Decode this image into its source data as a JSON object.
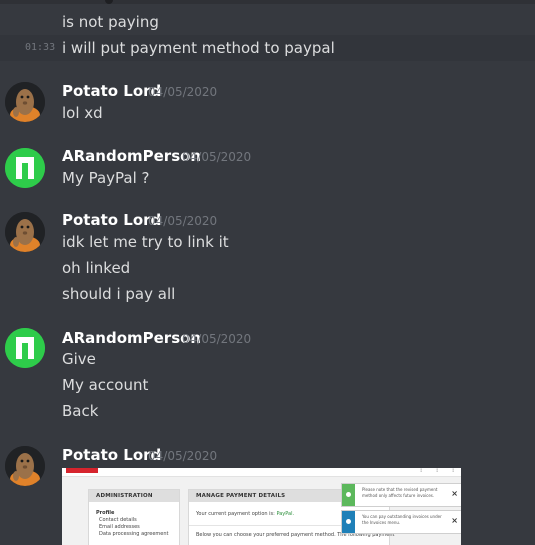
{
  "continuation": {
    "line1": "is not paying",
    "line2_time": "01:33",
    "line2": "i will put payment method to paypal"
  },
  "messages": [
    {
      "author": "Potato Lord",
      "date": "04/05/2020",
      "avatar": "potato-avatar",
      "lines": [
        "lol xd"
      ]
    },
    {
      "author": "ARandomPerson",
      "date": "04/05/2020",
      "avatar": "manjaro-logo-avatar",
      "lines": [
        "My PayPal ?"
      ]
    },
    {
      "author": "Potato Lord",
      "date": "04/05/2020",
      "avatar": "potato-avatar",
      "lines": [
        "idk let me try to link it",
        "oh linked",
        "should i pay all"
      ]
    },
    {
      "author": "ARandomPerson",
      "date": "04/05/2020",
      "avatar": "manjaro-logo-avatar",
      "lines": [
        "Give",
        "My account",
        "Back"
      ]
    },
    {
      "author": "Potato Lord",
      "date": "04/05/2020",
      "avatar": "potato-avatar",
      "lines": []
    }
  ],
  "embed": {
    "admin_header": "ADMINISTRATION",
    "profile": "Profile",
    "menu": [
      "Contact details",
      "Email addresses",
      "Data processing agreement"
    ],
    "manage_header": "MANAGE PAYMENT DETAILS",
    "current_option_prefix": "Your current payment option is:",
    "current_option_value": "PayPal.",
    "choose_text": "Below you can choose your preferred payment method. The following payment",
    "toasts": [
      {
        "text": "Please note that the revised payment method only affects future invoices.",
        "close": "×"
      },
      {
        "text": "You can pay outstanding invoices under the Invoices menu.",
        "close": "×"
      }
    ]
  },
  "colors": {
    "background": "#36393f",
    "text": "#dcddde",
    "author": "#ffffff",
    "timestamp": "#72767d",
    "manjaro_green": "#2ecc4a",
    "toast_green": "#5cb85c",
    "toast_blue": "#1f80b8"
  }
}
